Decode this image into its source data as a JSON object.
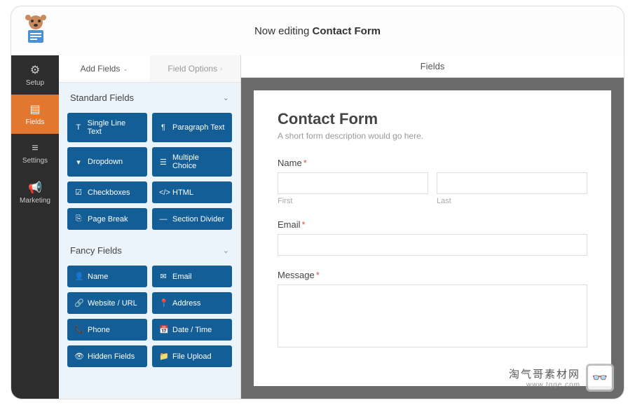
{
  "header": {
    "prefix": "Now editing ",
    "title": "Contact Form"
  },
  "sidebar": {
    "items": [
      {
        "label": "Setup",
        "icon": "⚙"
      },
      {
        "label": "Fields",
        "icon": "▤"
      },
      {
        "label": "Settings",
        "icon": "≡"
      },
      {
        "label": "Marketing",
        "icon": "📢"
      }
    ]
  },
  "panel": {
    "tabs": {
      "add": "Add Fields",
      "options": "Field Options"
    },
    "groups": {
      "standard": {
        "title": "Standard Fields",
        "fields": [
          {
            "label": "Single Line Text",
            "icon": "T"
          },
          {
            "label": "Paragraph Text",
            "icon": "¶"
          },
          {
            "label": "Dropdown",
            "icon": "▾"
          },
          {
            "label": "Multiple Choice",
            "icon": "☰"
          },
          {
            "label": "Checkboxes",
            "icon": "☑"
          },
          {
            "label": "HTML",
            "icon": "</>"
          },
          {
            "label": "Page Break",
            "icon": "⎘"
          },
          {
            "label": "Section Divider",
            "icon": "—"
          }
        ]
      },
      "fancy": {
        "title": "Fancy Fields",
        "fields": [
          {
            "label": "Name",
            "icon": "👤"
          },
          {
            "label": "Email",
            "icon": "✉"
          },
          {
            "label": "Website / URL",
            "icon": "🔗"
          },
          {
            "label": "Address",
            "icon": "📍"
          },
          {
            "label": "Phone",
            "icon": "📞"
          },
          {
            "label": "Date / Time",
            "icon": "📅"
          },
          {
            "label": "Hidden Fields",
            "icon": "👁"
          },
          {
            "label": "File Upload",
            "icon": "📁"
          }
        ]
      }
    }
  },
  "canvas": {
    "header": "Fields",
    "form": {
      "title": "Contact Form",
      "description": "A short form description would go here.",
      "name_label": "Name",
      "first_sub": "First",
      "last_sub": "Last",
      "email_label": "Email",
      "message_label": "Message"
    }
  },
  "watermark": {
    "line1": "淘气哥素材网",
    "line2": "www.tqge.com"
  }
}
